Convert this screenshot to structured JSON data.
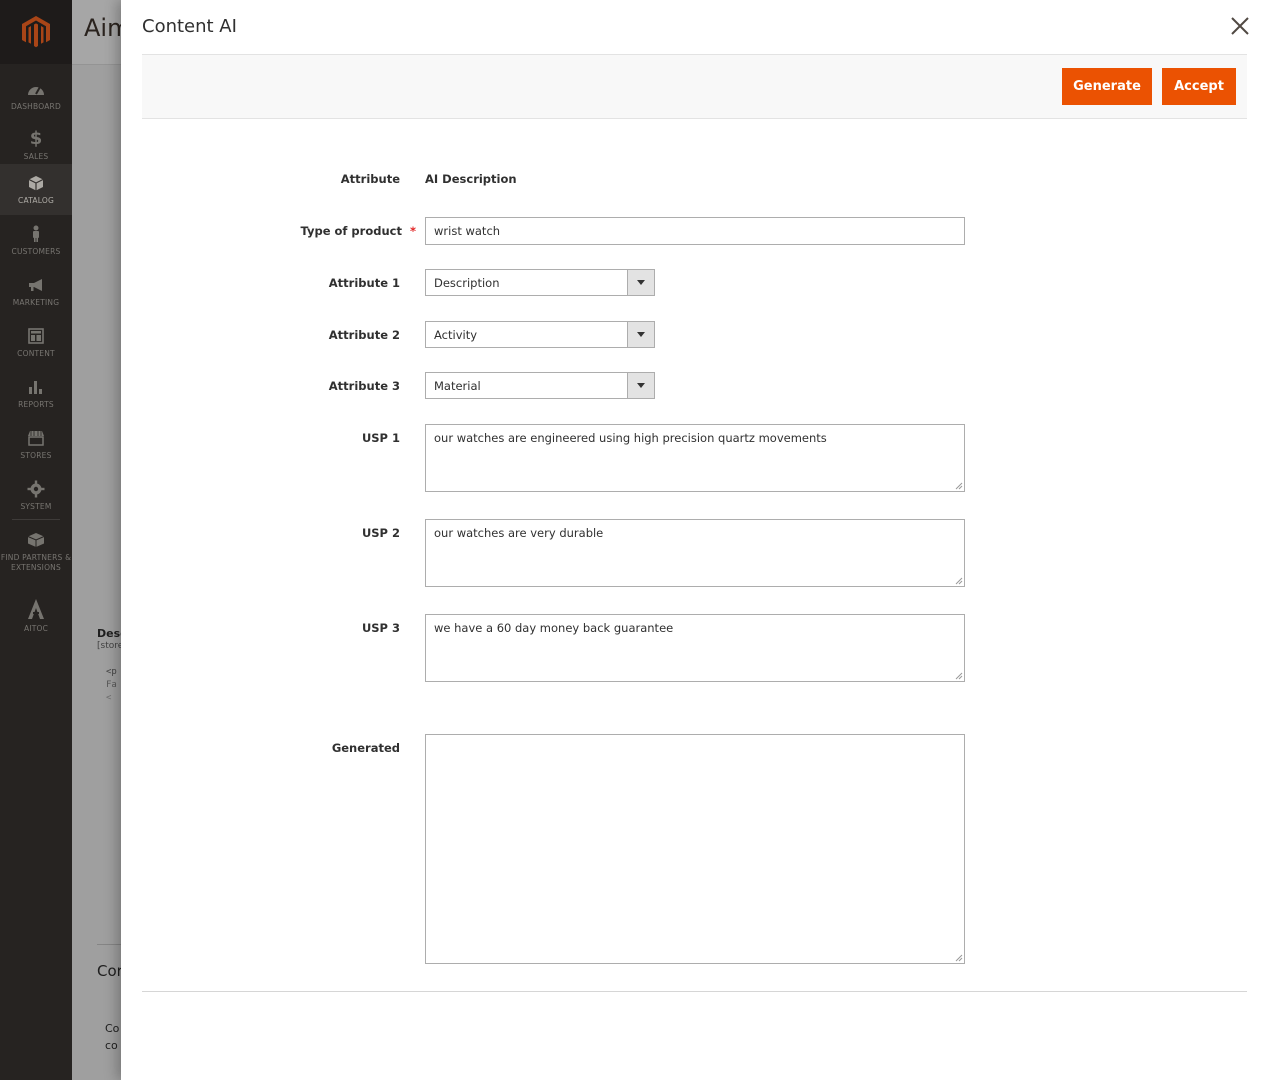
{
  "sidebar": {
    "items": [
      {
        "label": "DASHBOARD",
        "icon": "dashboard-icon"
      },
      {
        "label": "$",
        "icon": "dollar-icon"
      },
      {
        "label": "SALES"
      },
      {
        "label": "CATALOG",
        "icon": "box-icon"
      },
      {
        "label": "CUSTOMERS",
        "icon": "person-icon"
      },
      {
        "label": "MARKETING",
        "icon": "megaphone-icon"
      },
      {
        "label": "CONTENT",
        "icon": "layout-icon"
      },
      {
        "label": "REPORTS",
        "icon": "bar-chart-icon"
      },
      {
        "label": "STORES",
        "icon": "store-icon"
      },
      {
        "label": "SYSTEM",
        "icon": "gear-icon"
      },
      {
        "label": "FIND PARTNERS & EXTENSIONS",
        "icon": "partners-icon"
      },
      {
        "label": "AITOC",
        "icon": "aitoc-icon"
      }
    ]
  },
  "background": {
    "title": "Aim",
    "desc_label": "Desc",
    "desc_scope": "[store",
    "code1": "<p",
    "code2": "Fa",
    "code3": "<",
    "section": "Cor",
    "line1": "Co",
    "line2": "co"
  },
  "modal": {
    "title": "Content AI",
    "buttons": {
      "generate": "Generate",
      "accept": "Accept"
    },
    "fields": {
      "attribute": {
        "label": "Attribute",
        "value": "AI Description"
      },
      "type_of_product": {
        "label": "Type of product",
        "required_mark": "*",
        "value": "wrist watch"
      },
      "attribute1": {
        "label": "Attribute 1",
        "value": "Description"
      },
      "attribute2": {
        "label": "Attribute 2",
        "value": "Activity"
      },
      "attribute3": {
        "label": "Attribute 3",
        "value": "Material"
      },
      "usp1": {
        "label": "USP 1",
        "value": "our watches are engineered using high precision quartz movements"
      },
      "usp2": {
        "label": "USP 2",
        "value": "our watches are very durable"
      },
      "usp3": {
        "label": "USP 3",
        "value": "we have a 60 day money back guarantee"
      },
      "generated": {
        "label": "Generated",
        "value": ""
      }
    }
  },
  "colors": {
    "accent": "#eb5202",
    "sidebar": "#373330",
    "required": "#e22626"
  }
}
